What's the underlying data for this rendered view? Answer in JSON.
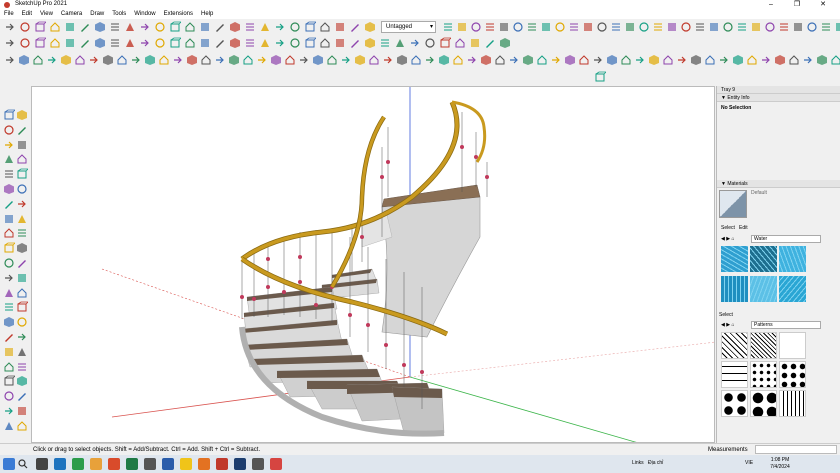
{
  "window": {
    "title": "SketchUp Pro 2021",
    "controls": [
      "–",
      "❐",
      "✕"
    ]
  },
  "menu": [
    "File",
    "Edit",
    "View",
    "Camera",
    "Draw",
    "Tools",
    "Window",
    "Extensions",
    "Help"
  ],
  "toolbar": {
    "tag_selector": "Untagged"
  },
  "tray": {
    "title": "Tray 9",
    "entity_info": {
      "header": "Entity Info",
      "selection": "No Selection"
    },
    "materials": {
      "header": "Materials",
      "current_name": "Default",
      "tabs": [
        "Select",
        "Edit"
      ],
      "library": "Water"
    },
    "patterns": {
      "section_label": "Select",
      "library": "Patterns"
    }
  },
  "status": {
    "message": "Click or drag to select objects. Shift = Add/Subtract. Ctrl = Add. Shift + Ctrl = Subtract.",
    "measurements_label": "Measurements"
  },
  "taskbar": {
    "links_label": "Links",
    "address_label": "Địa chỉ",
    "language": "VIE",
    "time": "1:08 PM",
    "date": "7/4/2024"
  },
  "colors": {
    "handrail": "#c99a1f",
    "tread": "#6b5a4c",
    "stone": "#cfcfcf",
    "water": "#2aa6d4",
    "axis_red": "#d9534f",
    "axis_green": "#3cb54a",
    "axis_blue": "#3b5bdb"
  },
  "icons": {
    "select": "arrow-icon",
    "paint": "paint-bucket-icon",
    "orbit": "orbit-icon",
    "zoom": "magnifier-icon"
  }
}
